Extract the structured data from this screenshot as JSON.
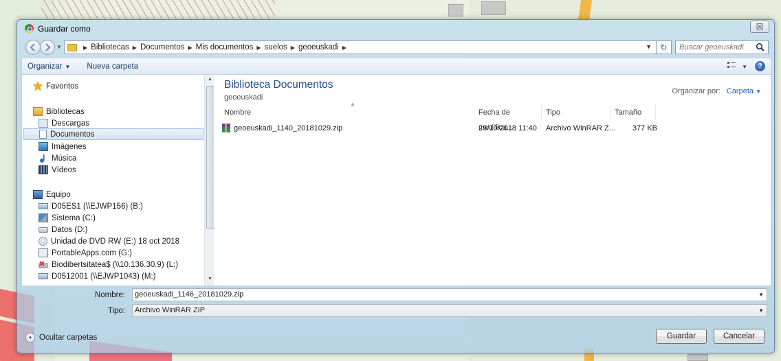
{
  "window": {
    "title": "Guardar como",
    "close_label": "☒"
  },
  "address": {
    "crumbs": [
      "Bibliotecas",
      "Documentos",
      "Mis documentos",
      "suelos",
      "geoeuskadi"
    ]
  },
  "search": {
    "placeholder": "Buscar geoeuskadi"
  },
  "toolbar": {
    "organize": "Organizar",
    "new_folder": "Nueva carpeta"
  },
  "nav": {
    "favorites": "Favoritos",
    "libraries": "Bibliotecas",
    "library_items": [
      "Descargas",
      "Documentos",
      "Imágenes",
      "Música",
      "Vídeos"
    ],
    "computer": "Equipo",
    "drives": [
      "D05ES1 (\\\\EJWP156) (B:)",
      "Sistema (C:)",
      "Datos (D:)",
      "Unidad de DVD RW (E:) 18 oct 2018",
      "PortableApps.com (G:)",
      "Biodibertsitatea$ (\\\\10.136.30.9) (L:)",
      "D0512001 (\\\\EJWP1043) (M:)"
    ]
  },
  "content": {
    "library_title": "Biblioteca Documentos",
    "library_subtitle": "geoeuskadi",
    "arrange_label": "Organizar por:",
    "arrange_value": "Carpeta",
    "columns": [
      "Nombre",
      "Fecha de modifica...",
      "Tipo",
      "Tamaño"
    ],
    "files": [
      {
        "name": "geoeuskadi_1140_20181029.zip",
        "date": "29/10/2018 11:40",
        "type": "Archivo WinRAR Z...",
        "size": "377 KB"
      }
    ]
  },
  "form": {
    "name_label": "Nombre:",
    "name_value": "geoeuskadi_1146_20181029.zip",
    "type_label": "Tipo:",
    "type_value": "Archivo WinRAR ZIP"
  },
  "footer": {
    "hide_folders": "Ocultar carpetas",
    "save": "Guardar",
    "cancel": "Cancelar"
  },
  "colors": {
    "accent": "#1f5db0",
    "title_blue": "#1e4c8a",
    "selection": "#d7e3f2"
  }
}
